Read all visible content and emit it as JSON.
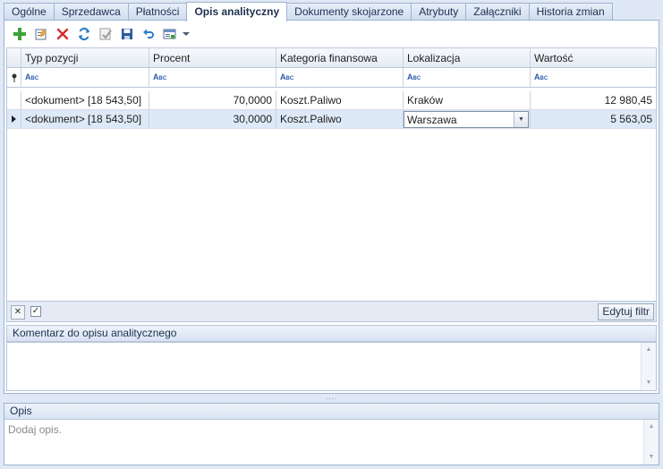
{
  "tabs": [
    "Ogólne",
    "Sprzedawca",
    "Płatności",
    "Opis analityczny",
    "Dokumenty skojarzone",
    "Atrybuty",
    "Załączniki",
    "Historia zmian"
  ],
  "active_tab": "Opis analityczny",
  "toolbar": {
    "buttons": [
      "add-icon",
      "edit-icon",
      "delete-icon",
      "refresh-icon",
      "approve-icon",
      "save-icon",
      "undo-icon",
      "view-icon",
      "dropdown-arrow-icon"
    ]
  },
  "grid": {
    "columns": [
      "Typ pozycji",
      "Procent",
      "Kategoria finansowa",
      "Lokalizacja",
      "Wartość"
    ],
    "filter_icon_text": "ABC",
    "rows": [
      {
        "typ": "<dokument> [18 543,50]",
        "procent": "70,0000",
        "kategoria": "Koszt.Paliwo",
        "lokalizacja": "Kraków",
        "wartosc": "12 980,45"
      },
      {
        "typ": "<dokument> [18 543,50]",
        "procent": "30,0000",
        "kategoria": "Koszt.Paliwo",
        "lokalizacja": "Warszawa",
        "wartosc": "5 563,05"
      }
    ],
    "selected_row": 1,
    "footer": {
      "edit_filter_label": "Edytuj filtr"
    }
  },
  "comment": {
    "title": "Komentarz do opisu analitycznego",
    "value": ""
  },
  "opis": {
    "title": "Opis",
    "placeholder": "Dodaj opis."
  },
  "colors": {
    "background": "#dfe8f5",
    "border": "#9db3d2",
    "selected_row": "#dde9f7"
  }
}
